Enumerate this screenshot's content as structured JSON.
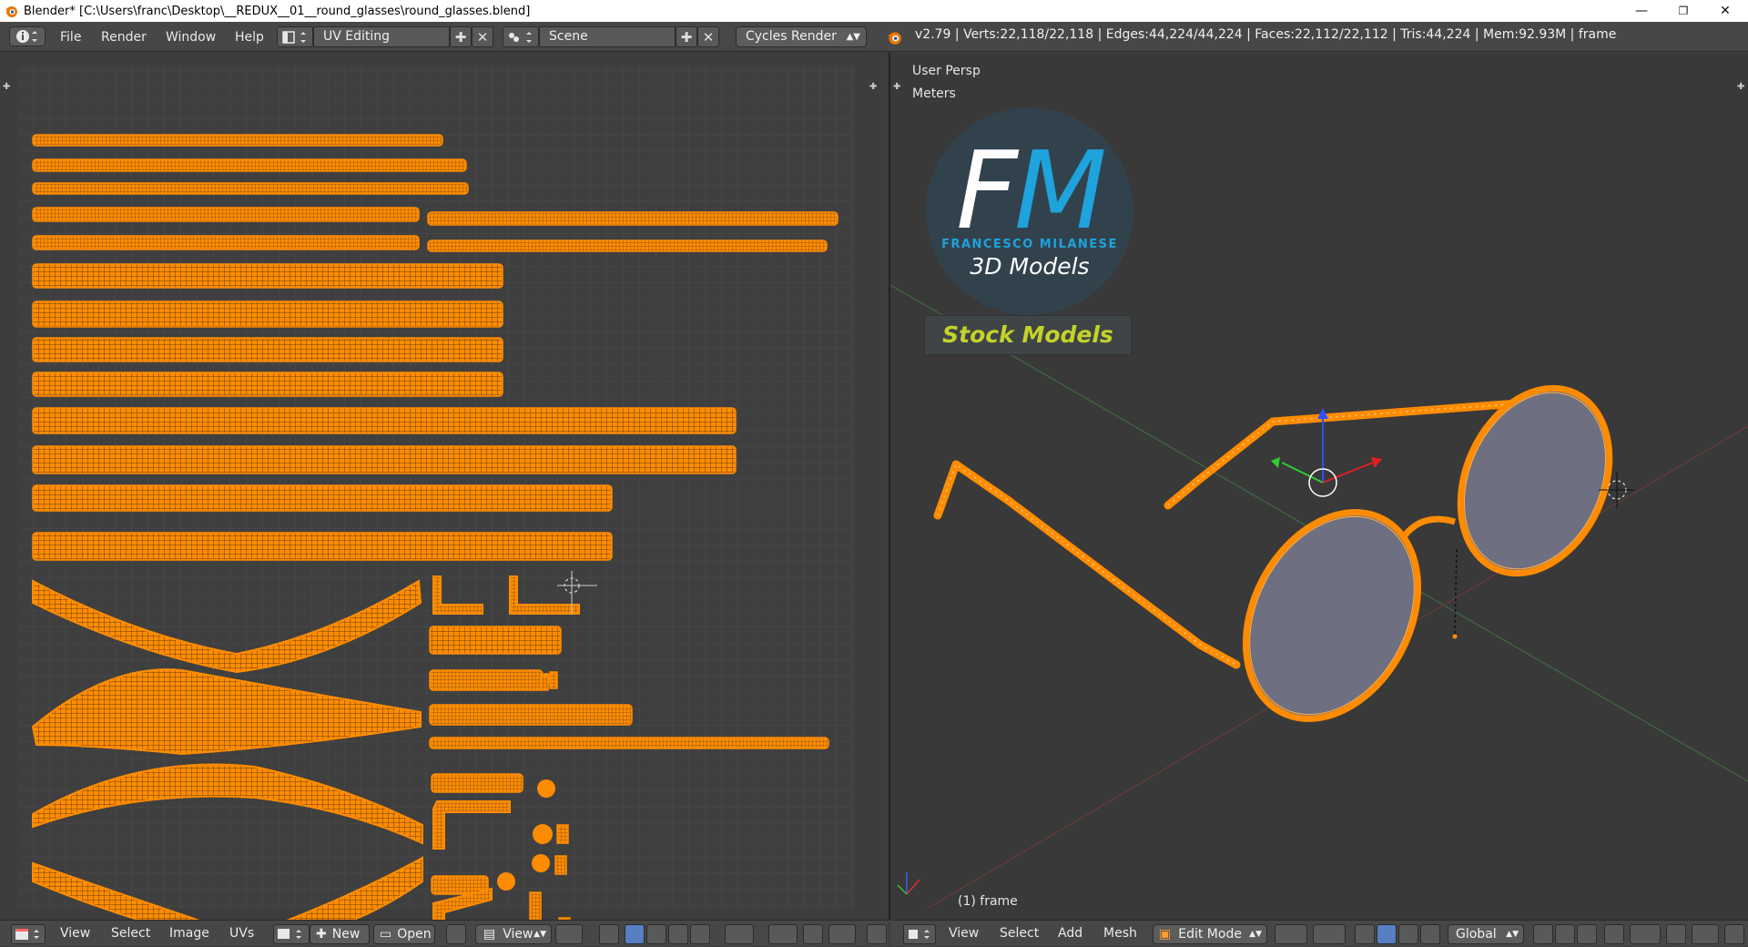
{
  "window": {
    "title": "Blender* [C:\\Users\\franc\\Desktop\\__REDUX__01__round_glasses\\round_glasses.blend]",
    "minimize": "—",
    "restore": "❐",
    "close": "✕"
  },
  "infobar": {
    "menus": [
      "File",
      "Render",
      "Window",
      "Help"
    ],
    "screen_layout": "UV Editing",
    "scene": "Scene",
    "render_engine": "Cycles Render",
    "stats": "v2.79 | Verts:22,118/22,118 | Edges:44,224/44,224 | Faces:22,112/22,112 | Tris:44,224 | Mem:92.93M | frame"
  },
  "viewport": {
    "view_name": "User Persp",
    "units": "Meters",
    "object_label": "(1) frame"
  },
  "logo": {
    "initial_f": "F",
    "initial_m": "M",
    "name": "FRANCESCO MILANESE",
    "tagline": "3D Models",
    "banner": "Stock Models"
  },
  "uv_header": {
    "menus": [
      "View",
      "Select",
      "Image",
      "UVs"
    ],
    "new_label": "New",
    "open_label": "Open",
    "view_label": "View"
  },
  "view3d_header": {
    "menus": [
      "View",
      "Select",
      "Add",
      "Mesh"
    ],
    "mode": "Edit Mode",
    "orientation": "Global"
  },
  "colors": {
    "uv_orange": "#ff8c00",
    "lens": "#6e6f80",
    "accent_blue": "#5680c2"
  },
  "icons": [
    "info-icon",
    "editor-type-icon",
    "blender-logo-icon",
    "image-icon",
    "pin-icon",
    "mesh-cube-icon",
    "shading-sphere-icon",
    "pivot-icon",
    "manipulator-icon"
  ]
}
